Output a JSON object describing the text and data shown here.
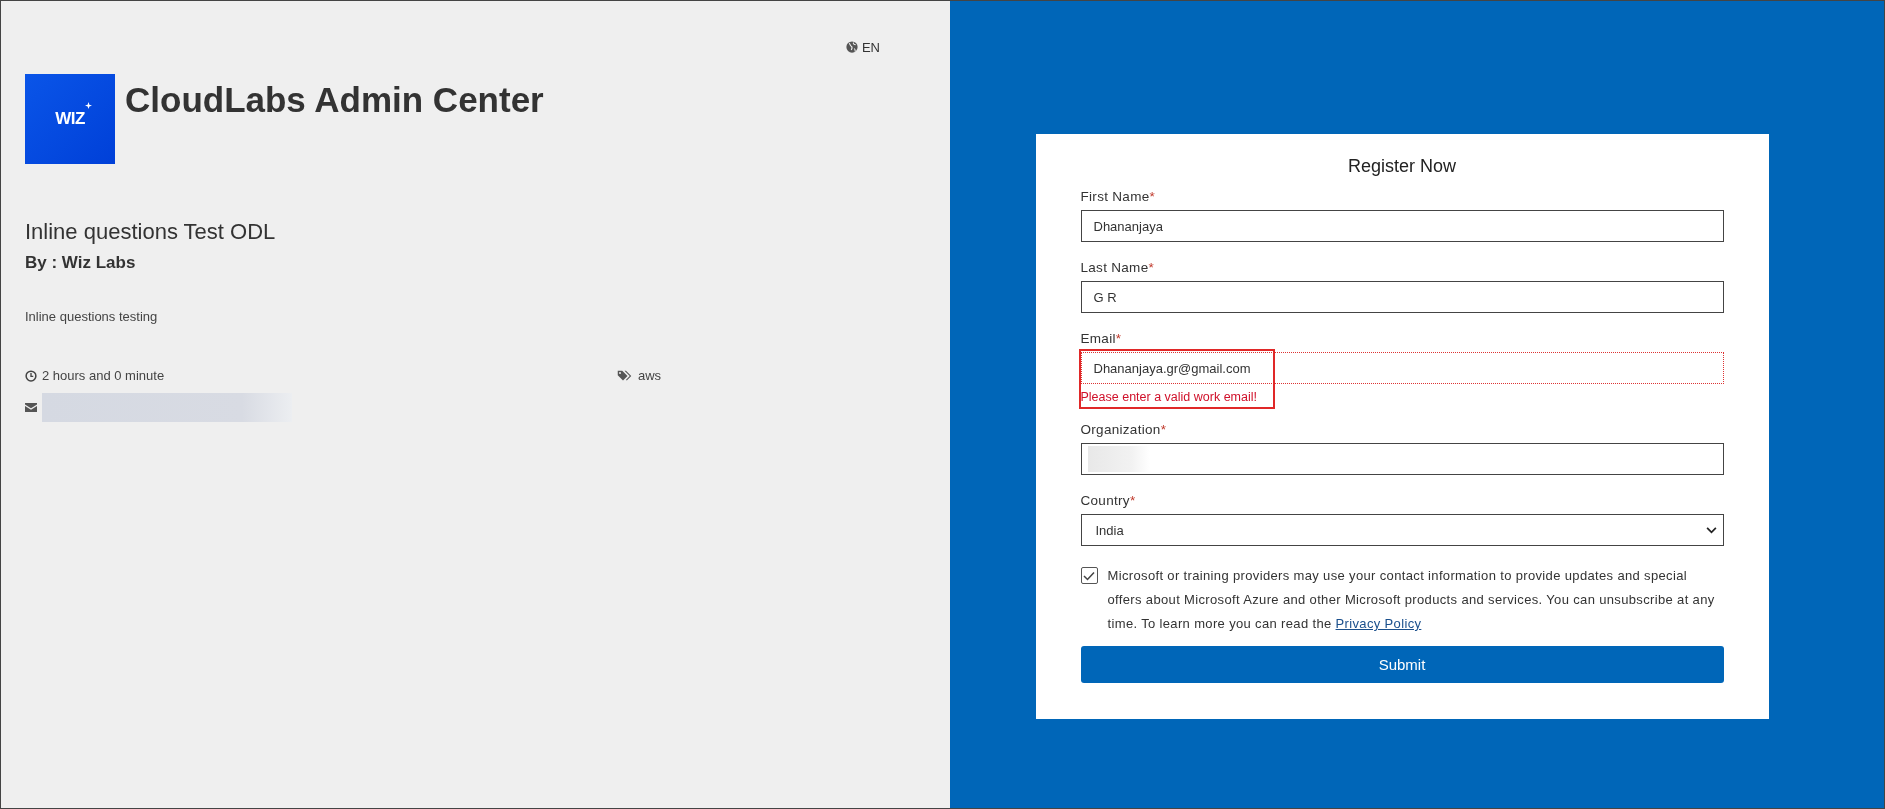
{
  "language": {
    "label": "EN"
  },
  "brand": {
    "logo_text": "WIZ",
    "title": "CloudLabs Admin Center"
  },
  "lab": {
    "title": "Inline questions Test ODL",
    "author": "By : Wiz Labs",
    "description": "Inline questions testing",
    "duration": "2 hours and 0 minute",
    "tag": "aws",
    "email_redacted": true
  },
  "form": {
    "title": "Register Now",
    "fields": [
      {
        "kind": "text",
        "label": "First Name",
        "required_mark": "*",
        "value": "Dhananjaya",
        "invalid": false,
        "highlighted": false
      },
      {
        "kind": "text",
        "label": "Last Name",
        "required_mark": "*",
        "value": "G R",
        "invalid": false,
        "highlighted": false
      },
      {
        "kind": "text",
        "label": "Email",
        "required_mark": "*",
        "value": "Dhananjaya.gr@gmail.com",
        "invalid": true,
        "error": "Please enter a valid work email!",
        "highlighted": true
      },
      {
        "kind": "redacted",
        "label": "Organization",
        "required_mark": "*",
        "invalid": false,
        "highlighted": false
      },
      {
        "kind": "select",
        "label": "Country",
        "required_mark": "*",
        "value": "India",
        "invalid": false,
        "highlighted": false
      }
    ],
    "consent": {
      "checked": true,
      "text": "Microsoft or training providers may use your contact information to provide updates and special offers about Microsoft Azure and other Microsoft products and services. You can unsubscribe at any time. To learn more you can read the",
      "link": "Privacy Policy"
    },
    "submit": "Submit"
  }
}
